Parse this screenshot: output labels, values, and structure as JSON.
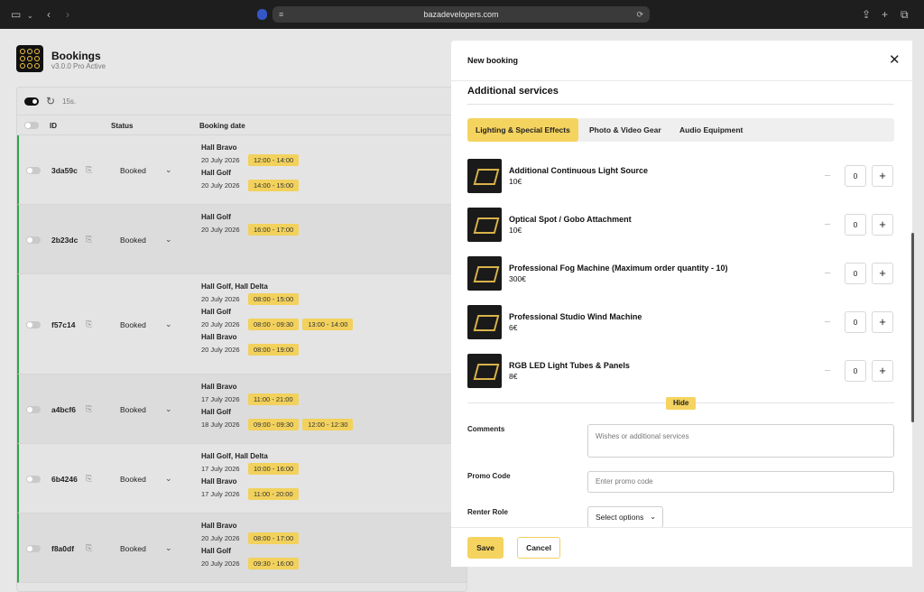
{
  "browser": {
    "url": "bazadevelopers.com"
  },
  "app": {
    "title": "Bookings",
    "version": "v3.0.0 Pro Active",
    "refresh_interval": "15s."
  },
  "table": {
    "headers": {
      "id": "ID",
      "status": "Status",
      "booking_date": "Booking date"
    },
    "rows": [
      {
        "id": "3da59c",
        "status": "Booked",
        "bookings": [
          {
            "hall": "Hall Bravo",
            "date": "20 July 2026",
            "slots": [
              "12:00 - 14:00"
            ]
          },
          {
            "hall": "Hall Golf",
            "date": "20 July 2026",
            "slots": [
              "14:00 - 15:00"
            ]
          }
        ]
      },
      {
        "id": "2b23dc",
        "status": "Booked",
        "bookings": [
          {
            "hall": "Hall Golf",
            "date": "20 July 2026",
            "slots": [
              "16:00 - 17:00"
            ]
          }
        ]
      },
      {
        "id": "f57c14",
        "status": "Booked",
        "bookings": [
          {
            "hall": "Hall Golf, Hall Delta",
            "date": "20 July 2026",
            "slots": [
              "08:00 - 15:00"
            ]
          },
          {
            "hall": "Hall Golf",
            "date": "20 July 2026",
            "slots": [
              "08:00 - 09:30",
              "13:00 - 14:00"
            ]
          },
          {
            "hall": "Hall Bravo",
            "date": "20 July 2026",
            "slots": [
              "08:00 - 19:00"
            ]
          }
        ]
      },
      {
        "id": "a4bcf6",
        "status": "Booked",
        "bookings": [
          {
            "hall": "Hall Bravo",
            "date": "17 July 2026",
            "slots": [
              "11:00 - 21:00"
            ]
          },
          {
            "hall": "Hall Golf",
            "date": "18 July 2026",
            "slots": [
              "09:00 - 09:30",
              "12:00 - 12:30"
            ]
          }
        ]
      },
      {
        "id": "6b4246",
        "status": "Booked",
        "bookings": [
          {
            "hall": "Hall Golf, Hall Delta",
            "date": "17 July 2026",
            "slots": [
              "10:00 - 16:00"
            ]
          },
          {
            "hall": "Hall Bravo",
            "date": "17 July 2026",
            "slots": [
              "11:00 - 20:00"
            ]
          }
        ]
      },
      {
        "id": "f8a0df",
        "status": "Booked",
        "bookings": [
          {
            "hall": "Hall Bravo",
            "date": "20 July 2026",
            "slots": [
              "08:00 - 17:00"
            ]
          },
          {
            "hall": "Hall Golf",
            "date": "20 July 2026",
            "slots": [
              "09:30 - 16:00"
            ]
          }
        ]
      }
    ]
  },
  "panel": {
    "title": "New booking",
    "section_title": "Additional services",
    "tabs": [
      {
        "label": "Lighting & Special Effects",
        "active": true
      },
      {
        "label": "Photo & Video Gear",
        "active": false
      },
      {
        "label": "Audio Equipment",
        "active": false
      }
    ],
    "items": [
      {
        "name": "Additional Continuous Light Source",
        "price": "10€",
        "qty": "0"
      },
      {
        "name": "Optical Spot / Gobo Attachment",
        "price": "10€",
        "qty": "0"
      },
      {
        "name": "Professional Fog Machine (Maximum order quantity - 10)",
        "price": "300€",
        "qty": "0"
      },
      {
        "name": "Professional Studio Wind Machine",
        "price": "6€",
        "qty": "0"
      },
      {
        "name": "RGB LED Light Tubes & Panels",
        "price": "8€",
        "qty": "0"
      }
    ],
    "hide_label": "Hide",
    "comments_label": "Comments",
    "comments_placeholder": "Wishes or additional services",
    "promo_label": "Promo Code",
    "promo_placeholder": "Enter promo code",
    "role_label": "Renter Role",
    "role_value": "Select options",
    "save_label": "Save",
    "cancel_label": "Cancel"
  },
  "colors": {
    "accent": "#f5d35f",
    "status_bar": "#2fa54b"
  }
}
